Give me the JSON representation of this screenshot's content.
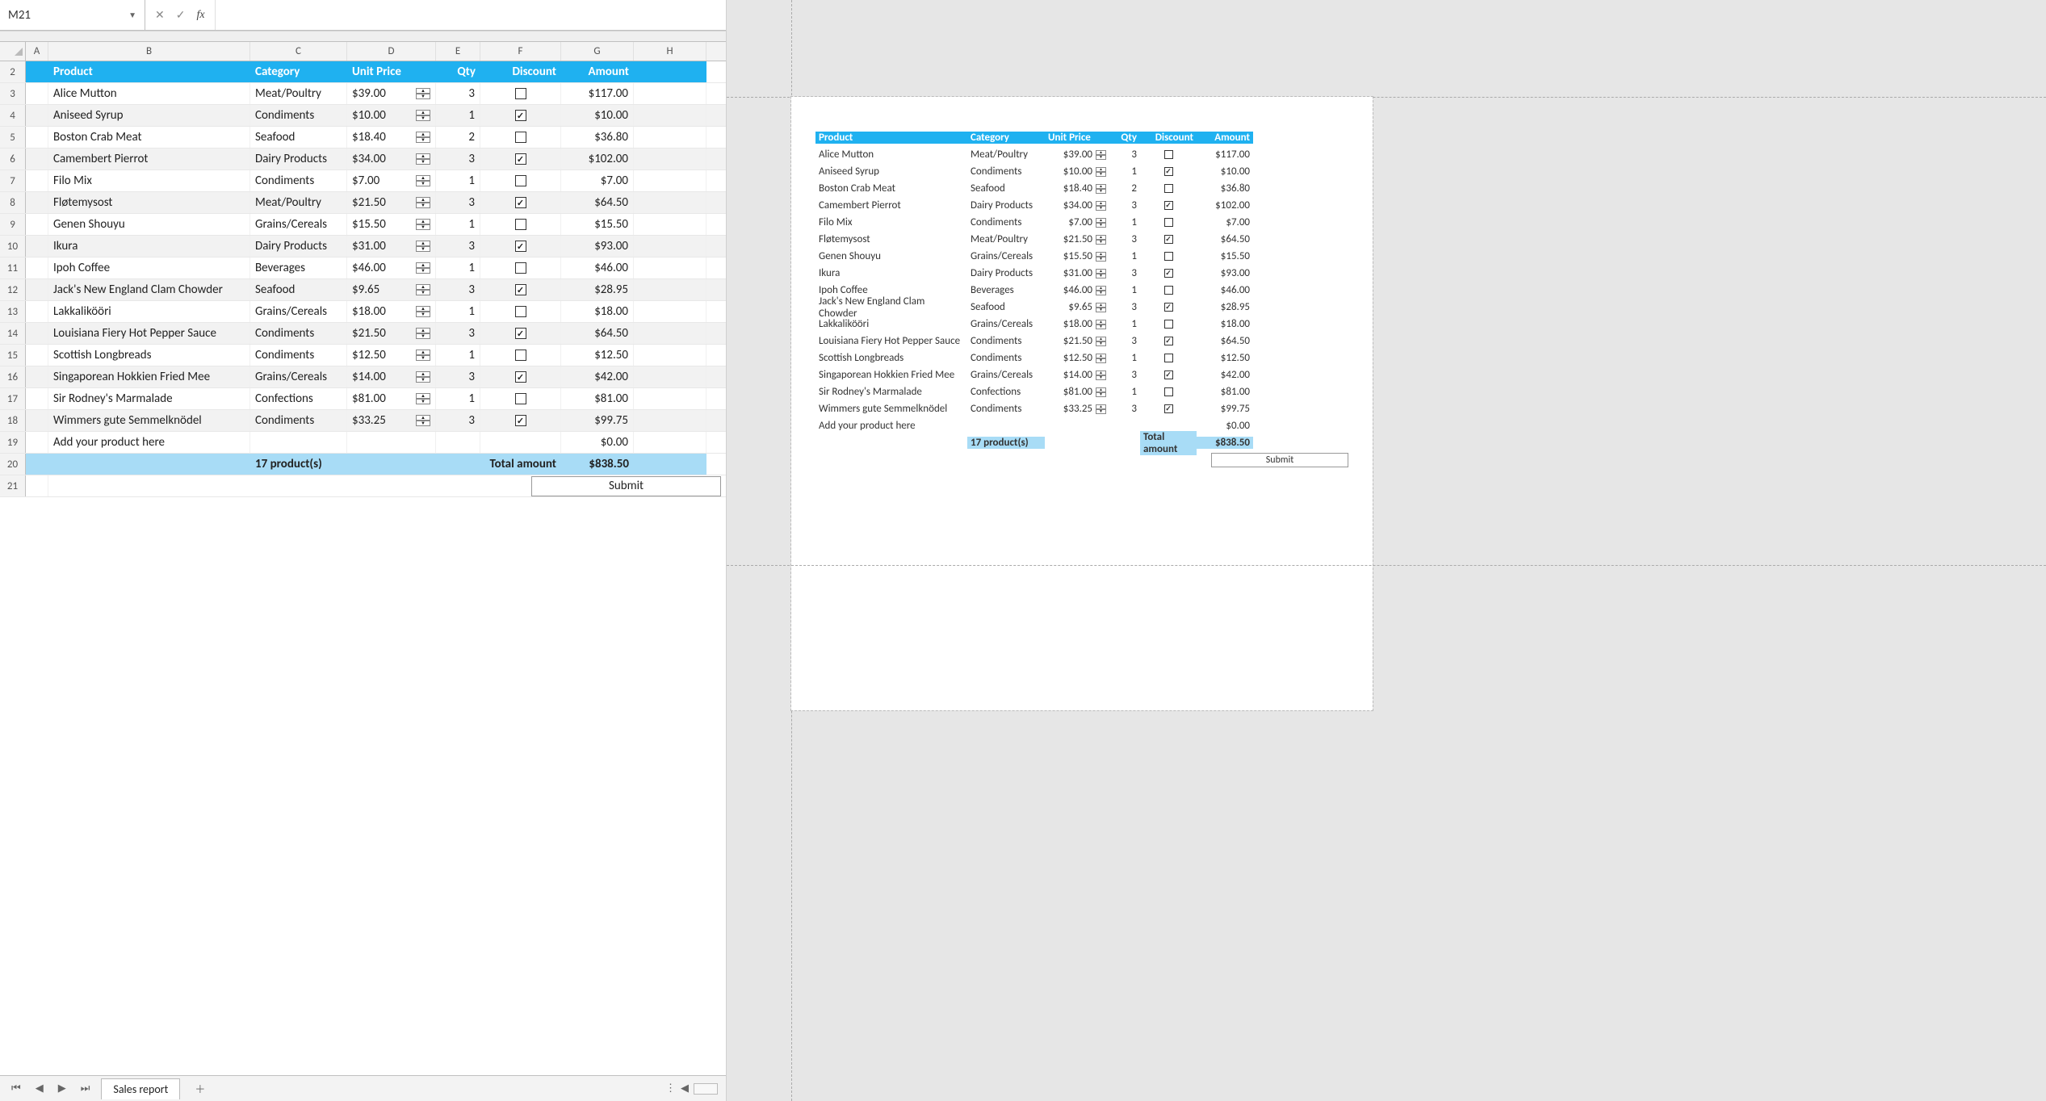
{
  "formulaBar": {
    "cellRef": "M21",
    "formula": ""
  },
  "colLetters": [
    "A",
    "B",
    "C",
    "D",
    "E",
    "F",
    "G",
    "H"
  ],
  "rowNums": [
    2,
    3,
    4,
    5,
    6,
    7,
    8,
    9,
    10,
    11,
    12,
    13,
    14,
    15,
    16,
    17,
    18,
    19,
    20,
    21
  ],
  "headers": {
    "product": "Product",
    "category": "Category",
    "unitPrice": "Unit Price",
    "qty": "Qty",
    "discount": "Discount",
    "amount": "Amount"
  },
  "rows": [
    {
      "product": "Alice Mutton",
      "category": "Meat/Poultry",
      "unitPrice": "$39.00",
      "qty": "3",
      "discount": false,
      "amount": "$117.00"
    },
    {
      "product": "Aniseed Syrup",
      "category": "Condiments",
      "unitPrice": "$10.00",
      "qty": "1",
      "discount": true,
      "amount": "$10.00"
    },
    {
      "product": "Boston Crab Meat",
      "category": "Seafood",
      "unitPrice": "$18.40",
      "qty": "2",
      "discount": false,
      "amount": "$36.80"
    },
    {
      "product": "Camembert Pierrot",
      "category": "Dairy Products",
      "unitPrice": "$34.00",
      "qty": "3",
      "discount": true,
      "amount": "$102.00"
    },
    {
      "product": "Filo Mix",
      "category": "Condiments",
      "unitPrice": "$7.00",
      "qty": "1",
      "discount": false,
      "amount": "$7.00"
    },
    {
      "product": "Fløtemysost",
      "category": "Meat/Poultry",
      "unitPrice": "$21.50",
      "qty": "3",
      "discount": true,
      "amount": "$64.50"
    },
    {
      "product": "Genen Shouyu",
      "category": "Grains/Cereals",
      "unitPrice": "$15.50",
      "qty": "1",
      "discount": false,
      "amount": "$15.50"
    },
    {
      "product": "Ikura",
      "category": "Dairy Products",
      "unitPrice": "$31.00",
      "qty": "3",
      "discount": true,
      "amount": "$93.00"
    },
    {
      "product": "Ipoh Coffee",
      "category": "Beverages",
      "unitPrice": "$46.00",
      "qty": "1",
      "discount": false,
      "amount": "$46.00"
    },
    {
      "product": "Jack's New England Clam Chowder",
      "category": "Seafood",
      "unitPrice": "$9.65",
      "qty": "3",
      "discount": true,
      "amount": "$28.95"
    },
    {
      "product": "Lakkalikööri",
      "category": "Grains/Cereals",
      "unitPrice": "$18.00",
      "qty": "1",
      "discount": false,
      "amount": "$18.00"
    },
    {
      "product": "Louisiana Fiery Hot Pepper Sauce",
      "category": "Condiments",
      "unitPrice": "$21.50",
      "qty": "3",
      "discount": true,
      "amount": "$64.50"
    },
    {
      "product": "Scottish Longbreads",
      "category": "Condiments",
      "unitPrice": "$12.50",
      "qty": "1",
      "discount": false,
      "amount": "$12.50"
    },
    {
      "product": "Singaporean Hokkien Fried Mee",
      "category": "Grains/Cereals",
      "unitPrice": "$14.00",
      "qty": "3",
      "discount": true,
      "amount": "$42.00"
    },
    {
      "product": "Sir Rodney's Marmalade",
      "category": "Confections",
      "unitPrice": "$81.00",
      "qty": "1",
      "discount": false,
      "amount": "$81.00"
    },
    {
      "product": "Wimmers gute Semmelknödel",
      "category": "Condiments",
      "unitPrice": "$33.25",
      "qty": "3",
      "discount": true,
      "amount": "$99.75"
    }
  ],
  "addRow": {
    "product": "Add your product here",
    "amount": "$0.00"
  },
  "totals": {
    "count": "17 product(s)",
    "label": "Total amount",
    "amount": "$838.50"
  },
  "submit": "Submit",
  "sheetTab": "Sales report"
}
